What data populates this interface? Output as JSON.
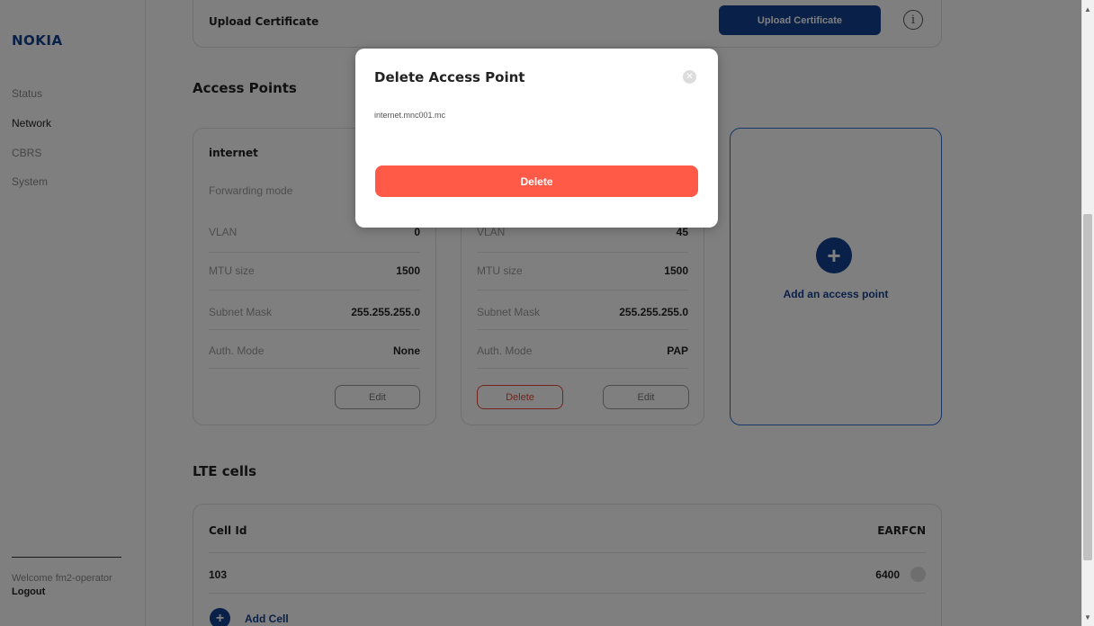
{
  "sidebar": {
    "logo": "NOKIA",
    "items": [
      {
        "label": "Status"
      },
      {
        "label": "Network"
      },
      {
        "label": "CBRS"
      },
      {
        "label": "System"
      }
    ],
    "welcome": "Welcome fm2-operator",
    "logout": "Logout"
  },
  "upload": {
    "title": "Upload Certificate",
    "button": "Upload Certificate"
  },
  "access_points": {
    "title": "Access Points",
    "cards": [
      {
        "name": "internet",
        "rows": [
          {
            "label": "Forwarding mode",
            "value": ""
          },
          {
            "label": "VLAN",
            "value": "0"
          },
          {
            "label": "MTU size",
            "value": "1500"
          },
          {
            "label": "Subnet Mask",
            "value": "255.255.255.0"
          },
          {
            "label": "Auth. Mode",
            "value": "None"
          }
        ],
        "edit_label": "Edit"
      },
      {
        "rows": [
          {
            "label": "VLAN",
            "value": "45"
          },
          {
            "label": "MTU size",
            "value": "1500"
          },
          {
            "label": "Subnet Mask",
            "value": "255.255.255.0"
          },
          {
            "label": "Auth. Mode",
            "value": "PAP"
          }
        ],
        "delete_label": "Delete",
        "edit_label": "Edit"
      }
    ],
    "add_label": "Add an access point"
  },
  "lte": {
    "title": "LTE cells",
    "columns": [
      "Cell Id",
      "EARFCN"
    ],
    "rows": [
      {
        "cell_id": "103",
        "earfcn": "6400"
      }
    ],
    "add_label": "Add Cell"
  },
  "modal": {
    "title": "Delete Access Point",
    "text": "internet.mnc001.mc",
    "delete_label": "Delete"
  },
  "colors": {
    "brand": "#124191",
    "danger": "#ff5a47"
  }
}
